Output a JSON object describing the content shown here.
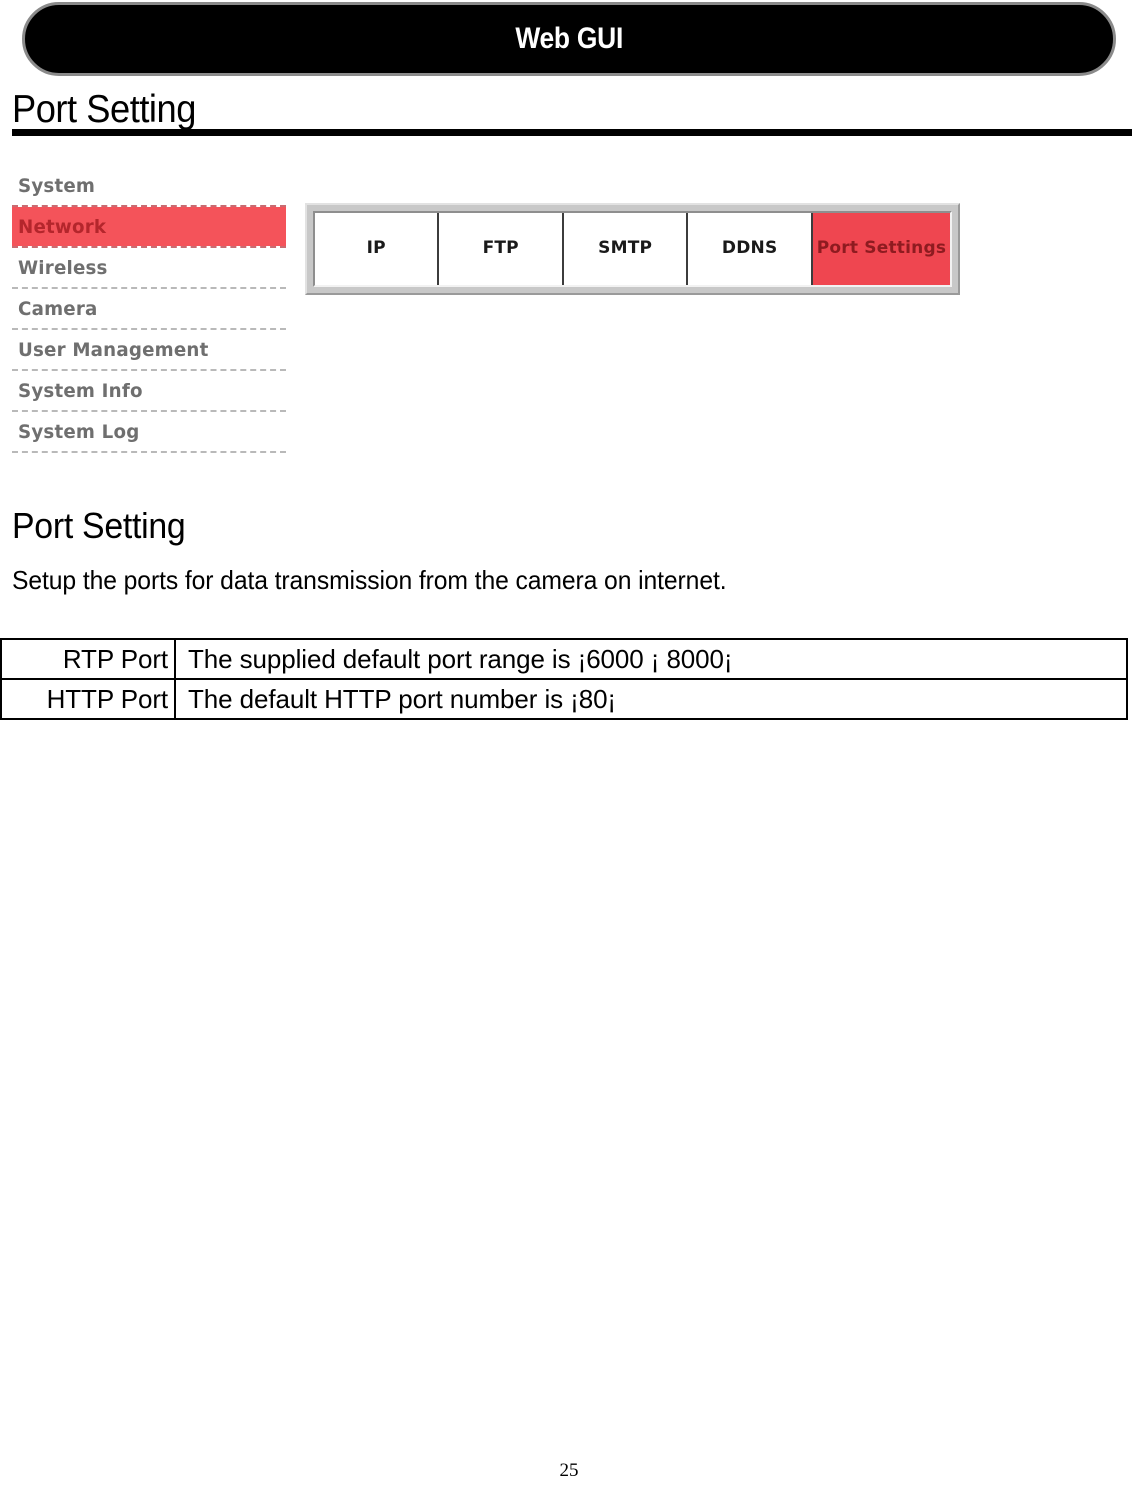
{
  "banner": {
    "title": "Web GUI"
  },
  "page_heading": {
    "text": "Port Setting"
  },
  "sidebar": {
    "items": [
      {
        "label": "System",
        "active": false
      },
      {
        "label": "Network",
        "active": true
      },
      {
        "label": "Wireless",
        "active": false
      },
      {
        "label": "Camera",
        "active": false
      },
      {
        "label": "User Management",
        "active": false
      },
      {
        "label": "System Info",
        "active": false
      },
      {
        "label": "System Log",
        "active": false
      }
    ]
  },
  "tabbar": {
    "tabs": [
      {
        "label": "IP",
        "active": false
      },
      {
        "label": "FTP",
        "active": false
      },
      {
        "label": "SMTP",
        "active": false
      },
      {
        "label": "DDNS",
        "active": false
      },
      {
        "label": "Port Settings",
        "active": true
      }
    ]
  },
  "section": {
    "title": "Port Setting",
    "description": "Setup the ports for data transmission from the camera on internet."
  },
  "spec_table": {
    "rows": [
      {
        "label": "RTP Port",
        "value": "The supplied default port range is ¡6000 ¡  8000¡"
      },
      {
        "label": "HTTP Port",
        "value": "The default HTTP port number is ¡80¡"
      }
    ]
  },
  "footer": {
    "page_number": "25"
  },
  "colors": {
    "accent_red": "#f4535a",
    "tab_active_red": "#ef4650",
    "tab_active_text": "#8e1b20",
    "sidebar_text": "#6f6f6f",
    "banner_bg": "#000000"
  }
}
